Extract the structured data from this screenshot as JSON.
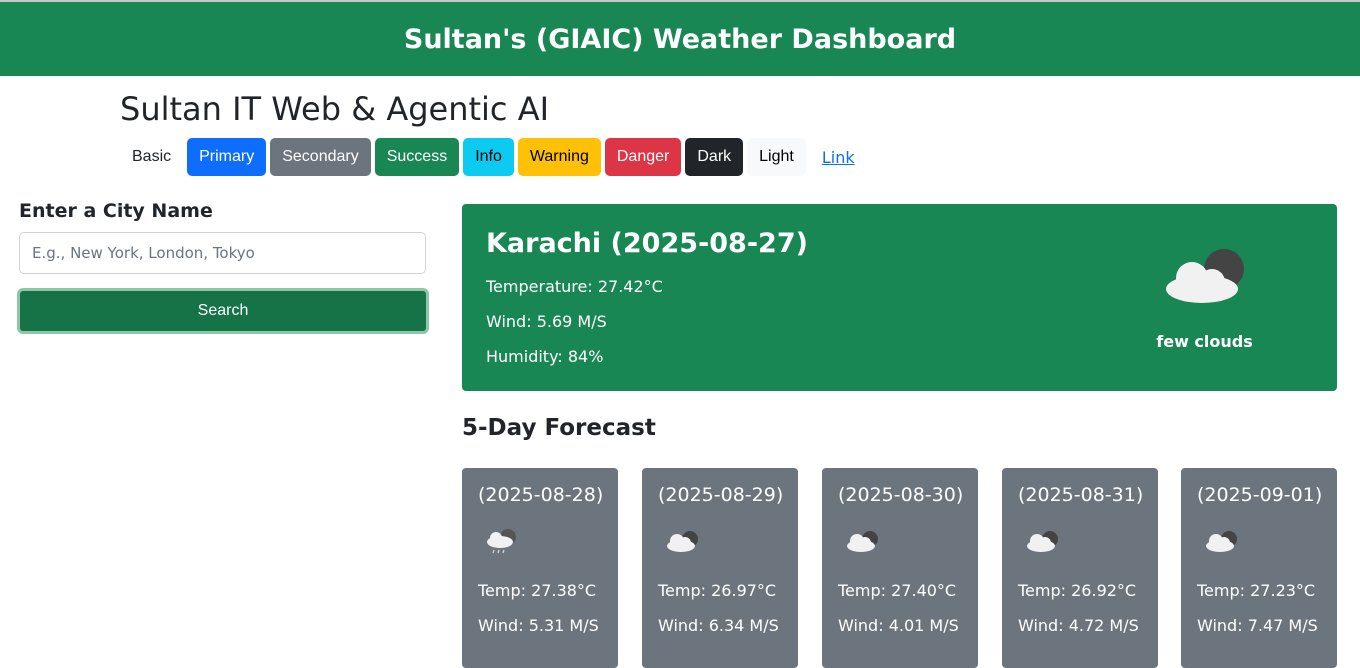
{
  "header": {
    "title": "Sultan's (GIAIC) Weather Dashboard"
  },
  "brand": {
    "title": "Sultan IT Web & Agentic AI"
  },
  "buttons": {
    "basic": "Basic",
    "primary": "Primary",
    "secondary": "Secondary",
    "success": "Success",
    "info": "Info",
    "warning": "Warning",
    "danger": "Danger",
    "dark": "Dark",
    "light": "Light",
    "link": "Link"
  },
  "search": {
    "label": "Enter a City Name",
    "placeholder": "E.g., New York, London, Tokyo",
    "button_label": "Search"
  },
  "current": {
    "title": "Karachi (2025-08-27)",
    "temperature": "Temperature: 27.42°C",
    "wind": "Wind: 5.69 M/S",
    "humidity": "Humidity: 84%",
    "description": "few clouds",
    "icon": "few-clouds-icon"
  },
  "forecast": {
    "heading": "5-Day Forecast",
    "days": [
      {
        "date": "(2025-08-28)",
        "temp": "Temp: 27.38°C",
        "wind": "Wind: 5.31 M/S",
        "icon": "rain-cloud-icon"
      },
      {
        "date": "(2025-08-29)",
        "temp": "Temp: 26.97°C",
        "wind": "Wind: 6.34 M/S",
        "icon": "cloud-icon"
      },
      {
        "date": "(2025-08-30)",
        "temp": "Temp: 27.40°C",
        "wind": "Wind: 4.01 M/S",
        "icon": "cloud-icon"
      },
      {
        "date": "(2025-08-31)",
        "temp": "Temp: 26.92°C",
        "wind": "Wind: 4.72 M/S",
        "icon": "cloud-icon"
      },
      {
        "date": "(2025-09-01)",
        "temp": "Temp: 27.23°C",
        "wind": "Wind: 7.47 M/S",
        "icon": "cloud-icon"
      }
    ]
  },
  "colors": {
    "header_bg": "#198754",
    "forecast_card_bg": "#6c757d",
    "search_button_bg": "#157347"
  }
}
